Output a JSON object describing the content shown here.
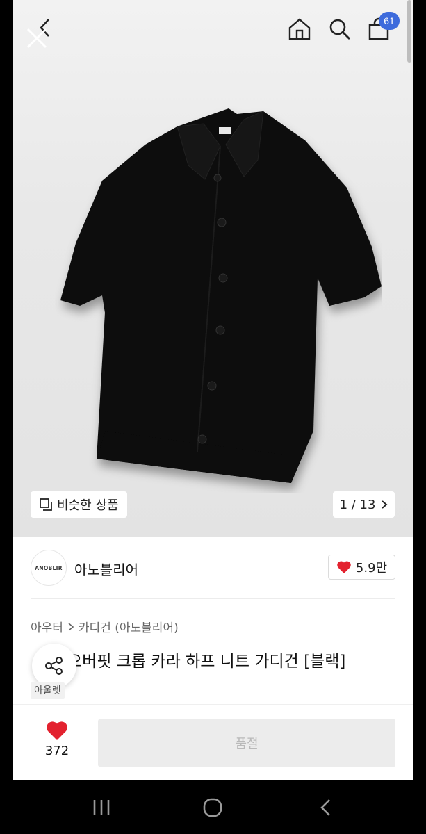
{
  "header": {
    "bag_count": "61",
    "icons": [
      "close-icon",
      "back-icon",
      "home-icon",
      "search-icon",
      "shopping-bag-icon"
    ]
  },
  "gallery": {
    "similar_label": "비슷한 상품",
    "counter": "1 / 13"
  },
  "seller": {
    "logo_text": "ANOBLIR",
    "name": "아노블리어",
    "likes": "5.9만"
  },
  "product": {
    "breadcrumb": [
      "아우터",
      "카디건 (아노블리어)"
    ],
    "title": "오버핏 크롭 카라 하프 니트 가디건 [블랙]",
    "store_tag": "아울렛"
  },
  "bottom_bar": {
    "wish_count": "372",
    "soldout_label": "품절"
  },
  "colors": {
    "badge": "#3d6bdc",
    "heart": "#e3222f"
  }
}
